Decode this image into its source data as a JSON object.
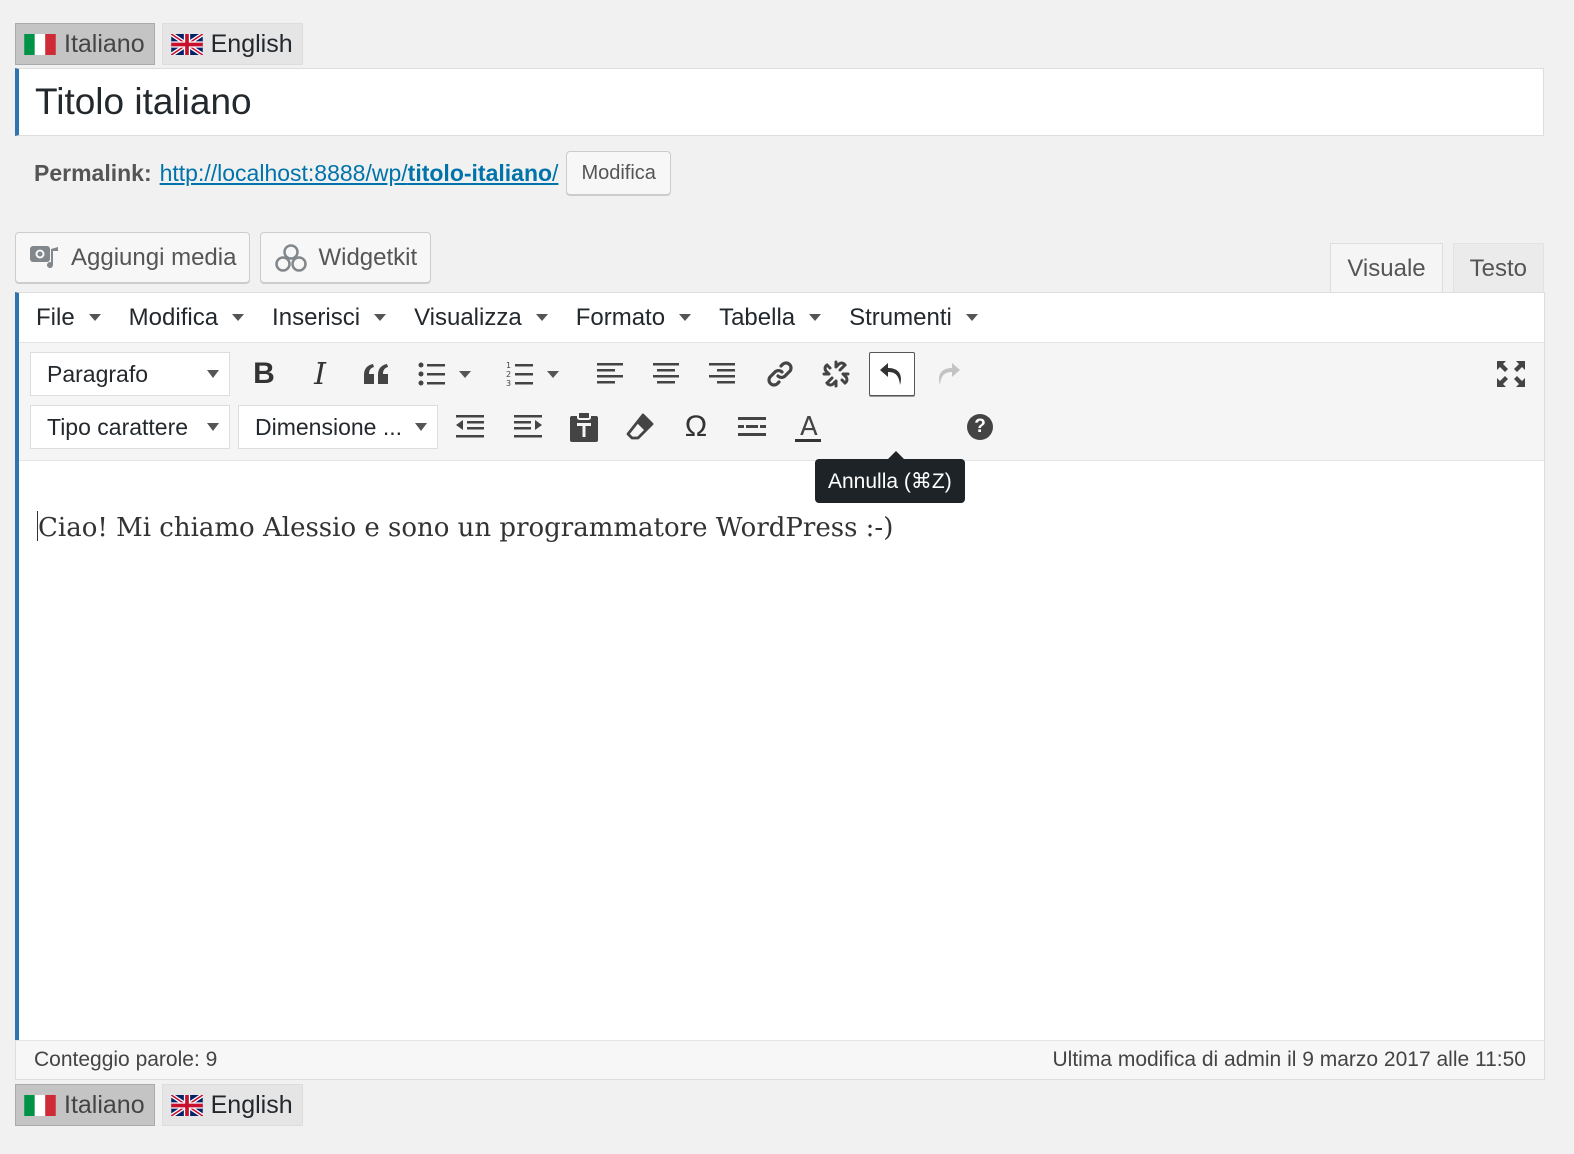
{
  "lang_tabs": [
    {
      "label": "Italiano",
      "flag": "flag-italy-icon",
      "active": true
    },
    {
      "label": "English",
      "flag": "flag-uk-icon",
      "active": false
    }
  ],
  "title": {
    "value": "Titolo italiano"
  },
  "permalink": {
    "label": "Permalink:",
    "url_prefix": "http://localhost:8888/wp/",
    "url_slug": "titolo-italiano",
    "url_suffix": "/",
    "edit_button": "Modifica"
  },
  "media_buttons": {
    "add_media": "Aggiungi media",
    "widgetkit": "Widgetkit"
  },
  "mode_tabs": {
    "visual": "Visuale",
    "text": "Testo",
    "active": "visual"
  },
  "menubar": [
    "File",
    "Modifica",
    "Inserisci",
    "Visualizza",
    "Formato",
    "Tabella",
    "Strumenti"
  ],
  "toolbar": {
    "format_select": "Paragrafo",
    "font_family_select": "Tipo carattere",
    "font_size_select": "Dimensione ...",
    "row1_icons": [
      "bold-icon",
      "italic-icon",
      "blockquote-icon",
      "bullet-list-icon",
      "numbered-list-icon",
      "align-left-icon",
      "align-center-icon",
      "align-right-icon",
      "link-icon",
      "unlink-icon",
      "undo-icon",
      "redo-icon",
      "fullscreen-icon"
    ],
    "row2_icons": [
      "outdent-icon",
      "indent-icon",
      "paste-text-icon",
      "clear-formatting-icon",
      "special-character-icon",
      "horizontal-line-icon",
      "text-color-icon",
      "help-icon"
    ],
    "bold_glyph": "B",
    "italic_glyph": "I",
    "omega_glyph": "Ω",
    "help_glyph": "?"
  },
  "tooltip": {
    "text": "Annulla (⌘Z)"
  },
  "content": {
    "text": "Ciao! Mi chiamo Alessio e sono un programmatore WordPress :-)"
  },
  "statusbar": {
    "word_count": "Conteggio parole: 9",
    "last_edit": "Ultima modifica di admin il 9 marzo 2017 alle 11:50"
  },
  "colors": {
    "accent": "#2e75b0",
    "link": "#0073aa",
    "tooltip_bg": "#1d2327"
  }
}
